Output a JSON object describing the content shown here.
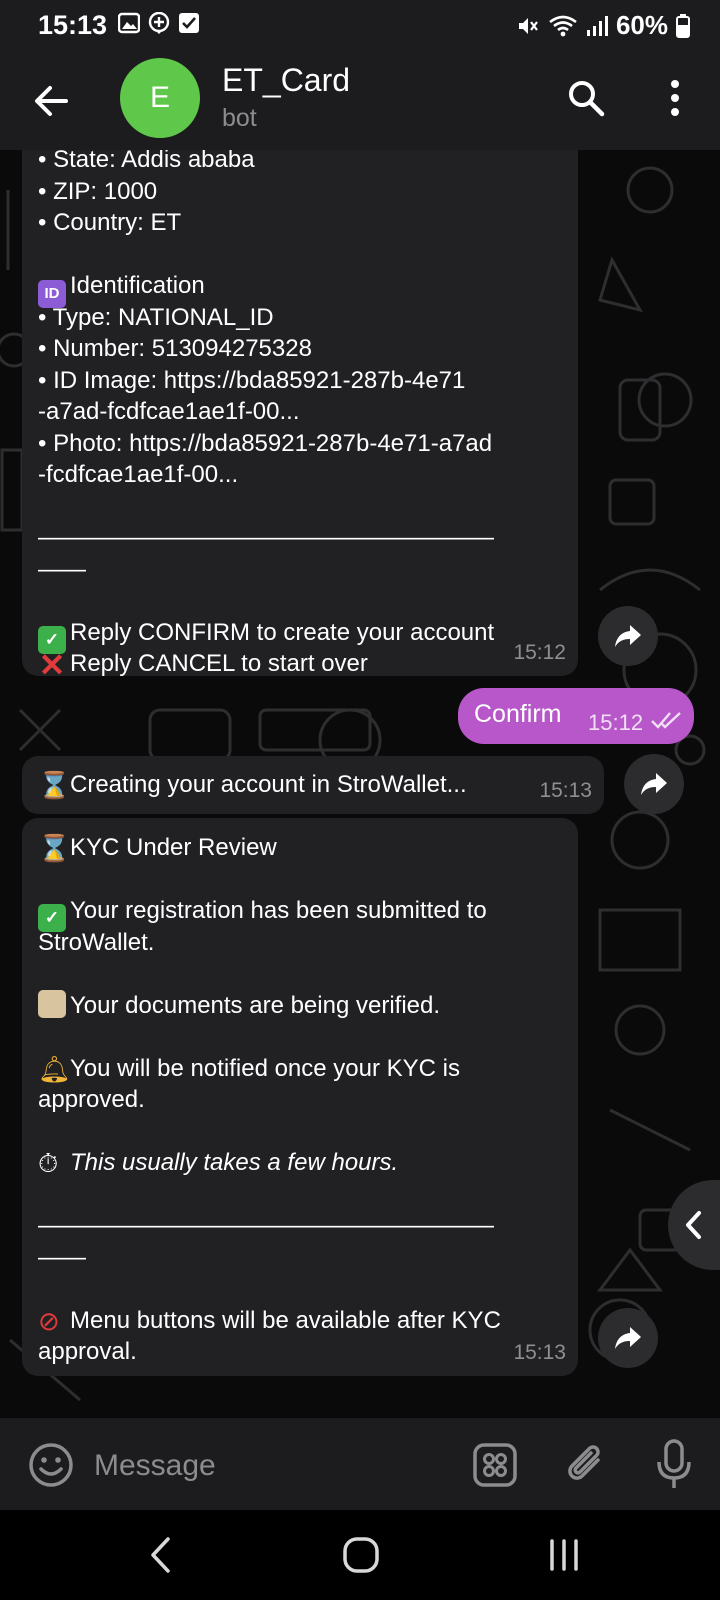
{
  "status_bar": {
    "time": "15:13",
    "battery": "60%",
    "icons": [
      "gallery-icon",
      "add-circle-icon",
      "check-box-icon",
      "mute-icon",
      "wifi-icon",
      "signal-icon",
      "battery-icon"
    ]
  },
  "header": {
    "avatar_letter": "E",
    "avatar_color": "#5fc84a",
    "title": "ET_Card",
    "subtitle": "bot"
  },
  "messages": {
    "m1": {
      "lines": [
        "• State: Addis ababa",
        "• ZIP: 1000",
        "• Country: ET",
        "",
        "Identification",
        "• Type: NATIONAL_ID",
        "• Number: 513094275328",
        "• ID Image: https://bda85921-287b-4e71",
        "-a7ad-fcdfcae1ae1f-00...",
        "• Photo: https://bda85921-287b-4e71-a7ad",
        "-fcdfcae1ae1f-00...",
        "",
        "———————————————————",
        "——",
        "",
        "Reply CONFIRM to create your account",
        "Reply CANCEL to start over"
      ],
      "time": "15:12"
    },
    "out": {
      "text": "Confirm",
      "time": "15:12"
    },
    "m2": {
      "text": "Creating your account in StroWallet...",
      "time": "15:13"
    },
    "m3": {
      "lines": [
        "KYC Under Review",
        "",
        "Your registration has been submitted to",
        "StroWallet.",
        "",
        "Your documents are being verified.",
        "",
        "You will be notified once your KYC is",
        "approved.",
        "",
        "This usually takes a few hours.",
        "",
        "———————————————————",
        "——",
        "",
        "Menu buttons will be available after KYC",
        "approval."
      ],
      "time": "15:13"
    }
  },
  "input_bar": {
    "placeholder": "Message"
  },
  "colors": {
    "outgoing_bubble": "#b757c9",
    "incoming_bubble": "#212124",
    "app_bar": "#1c1c1e"
  }
}
